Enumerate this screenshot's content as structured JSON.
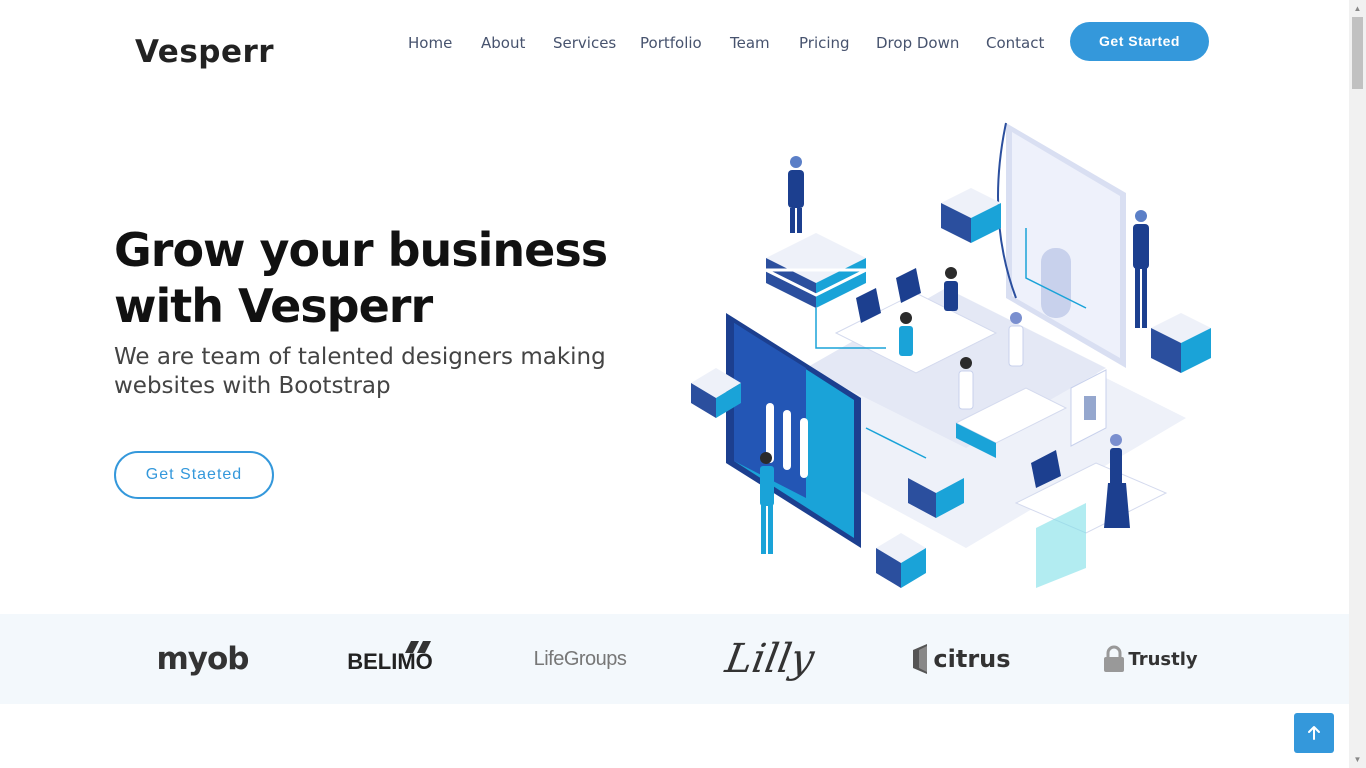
{
  "header": {
    "logo": "Vesperr",
    "nav": [
      "Home",
      "About",
      "Services",
      "Portfolio",
      "Team",
      "Pricing",
      "Drop Down",
      "Contact"
    ],
    "cta_label": "Get Started"
  },
  "hero": {
    "title_line1": "Grow your business",
    "title_line2": "with Vesperr",
    "subtitle_line1": "We are team of talented designers making",
    "subtitle_line2": "websites with Bootstrap",
    "button_label": "Get Staeted",
    "illustration_icon": "isometric-office-illustration"
  },
  "clients": {
    "logos": [
      "myob",
      "BELIMO",
      "LifeGroups",
      "Lilly",
      "citrus",
      "Trustly"
    ]
  },
  "back_to_top_icon": "arrow-up-icon",
  "colors": {
    "accent": "#3498db",
    "clients_bg": "#f3f8fc",
    "nav_text": "#47536e"
  }
}
